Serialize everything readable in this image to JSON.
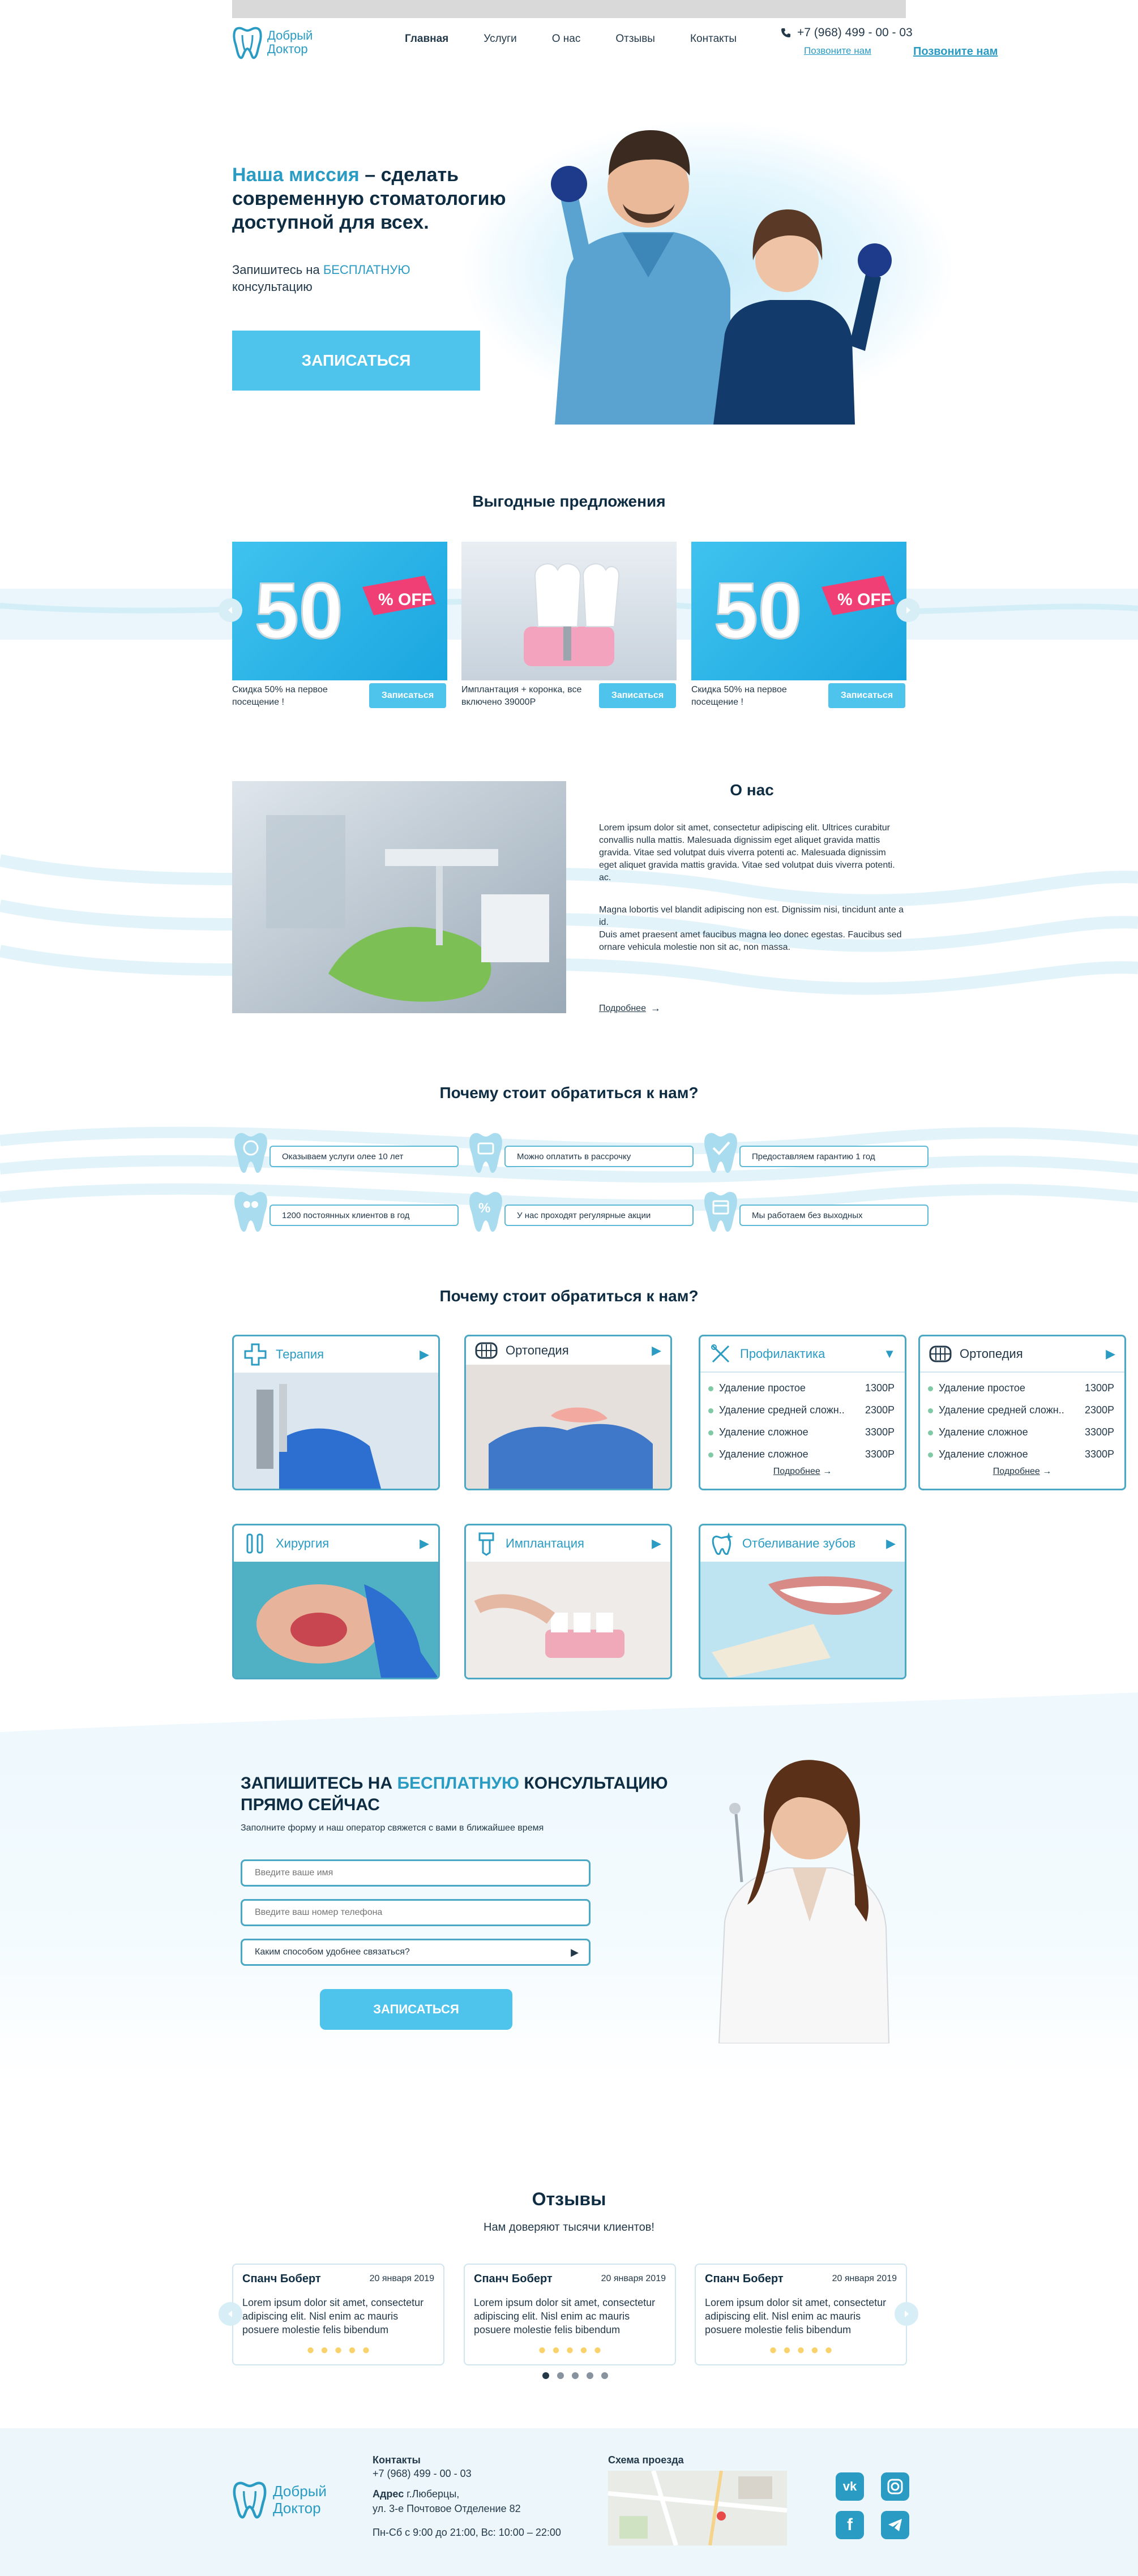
{
  "brand": {
    "name_line1": "Добрый",
    "name_line2": "Доктор",
    "color": "#2a9bc3"
  },
  "nav": [
    "Главная",
    "Услуги",
    "О нас",
    "Отзывы",
    "Контакты"
  ],
  "header": {
    "phone": "+7 (968) 499 - 00 - 03",
    "call_link": "Позвоните нам",
    "call_link_alt": "Позвоните нам"
  },
  "hero": {
    "title_accent": "Наша миссия",
    "title_rest": " – сделать современную стоматологию доступной для всех.",
    "sub_prefix": "Запишитесь на ",
    "sub_accent": "БЕСПЛАТНУЮ",
    "sub_suffix": " консультацию",
    "button": "ЗАПИСАТЬСЯ"
  },
  "offers": {
    "title": "Выгодные предложения",
    "items": [
      {
        "caption": "Скидка 50% на первое посещение !",
        "button": "Записаться",
        "badge": "50",
        "badge_tag": "% OFF"
      },
      {
        "caption": "Имплантация + коронка, все включено 39000Р",
        "button": "Записаться"
      },
      {
        "caption": "Скидка 50% на первое посещение !",
        "button": "Записаться",
        "badge": "50",
        "badge_tag": "% OFF"
      }
    ]
  },
  "about": {
    "title": "О нас",
    "p1": "Lorem ipsum dolor sit amet, consectetur adipiscing elit. Ultrices curabitur convallis nulla mattis. Malesuada dignissim eget aliquet gravida mattis gravida. Vitae sed volutpat duis viverra potenti ac. Malesuada dignissim eget aliquet gravida mattis gravida. Vitae sed volutpat duis viverra potenti. ac.",
    "p2": "Magna lobortis vel blandit adipiscing non est. Dignissim nisi, tincidunt ante a id.",
    "p3": "Duis amet praesent amet faucibus magna leo donec egestas. Faucibus sed ornare vehicula molestie non sit ac, non massa.",
    "more": "Подробнее"
  },
  "why": {
    "title": "Почему стоит обратиться к нам?",
    "items": [
      "Оказываем услуги олее 10 лет",
      "Можно оплатить в рассрочку",
      "Предоставляем гарантию 1 год",
      "1200  постоянных клиентов в год",
      "У нас проходят регулярные акции",
      "Мы работаем без выходных"
    ]
  },
  "services": {
    "title": "Почему стоит обратиться к нам?",
    "cards": [
      "Терапия",
      "Ортопедия",
      "Хирургия",
      "Имплантация",
      "Отбеливание зубов"
    ],
    "prophylaxis": {
      "title": "Профилактика",
      "rows": [
        {
          "name": "Удаление простое",
          "price": "1300Р"
        },
        {
          "name": "Удаление средней сложн..",
          "price": "2300Р"
        },
        {
          "name": "Удаление сложное",
          "price": "3300Р"
        },
        {
          "name": "Удаление сложное",
          "price": "3300Р"
        }
      ],
      "more": "Подробнее"
    },
    "orthopedics": {
      "title": "Ортопедия",
      "rows": [
        {
          "name": "Удаление простое",
          "price": "1300Р"
        },
        {
          "name": "Удаление средней сложн..",
          "price": "2300Р"
        },
        {
          "name": "Удаление сложное",
          "price": "3300Р"
        },
        {
          "name": "Удаление сложное",
          "price": "3300Р"
        }
      ],
      "more": "Подробнее"
    }
  },
  "consult": {
    "title_prefix": "ЗАПИШИТЕСЬ НА ",
    "title_accent": "БЕСПЛАТНУЮ",
    "title_suffix": " КОНСУЛЬТАЦИЮ ПРЯМО СЕЙЧАС",
    "sub": "Заполните форму и наш оператор свяжется с вами в ближайшее время",
    "name_placeholder": "Введите ваше имя",
    "phone_placeholder": "Введите ваш номер телефона",
    "contact_select": "Каким способом удобнее связаться?",
    "button": "ЗАПИСАТЬСЯ"
  },
  "reviews": {
    "title": "Отзывы",
    "sub": "Нам доверяют тысячи клиентов!",
    "items": [
      {
        "name": "Спанч Боберт",
        "date": "20 января 2019",
        "text": "Lorem ipsum dolor sit amet, consectetur adipiscing elit. Nisl enim ac mauris posuere molestie felis bibendum",
        "rating": 5
      },
      {
        "name": "Спанч Боберт",
        "date": "20 января 2019",
        "text": "Lorem ipsum dolor sit amet, consectetur adipiscing elit. Nisl enim ac mauris posuere molestie felis bibendum",
        "rating": 5
      },
      {
        "name": "Спанч Боберт",
        "date": "20 января 2019",
        "text": "Lorem ipsum dolor sit amet, consectetur adipiscing elit. Nisl enim ac mauris posuere molestie felis bibendum",
        "rating": 5
      }
    ],
    "pages": 5,
    "active_page": 1
  },
  "footer": {
    "contacts_label": "Контакты",
    "phone": "+7 (968) 499 - 00 - 03",
    "address_label": "Адрес",
    "address_line1": " г.Люберцы,",
    "address_line2": "ул. 3-е Почтовое Отделение 82",
    "hours": "Пн-Сб с 9:00 до 21:00, Вс: 10:00 – 22:00",
    "map_label": "Схема проезда",
    "socials": [
      "vk-icon",
      "instagram-icon",
      "facebook-icon",
      "telegram-icon"
    ]
  }
}
